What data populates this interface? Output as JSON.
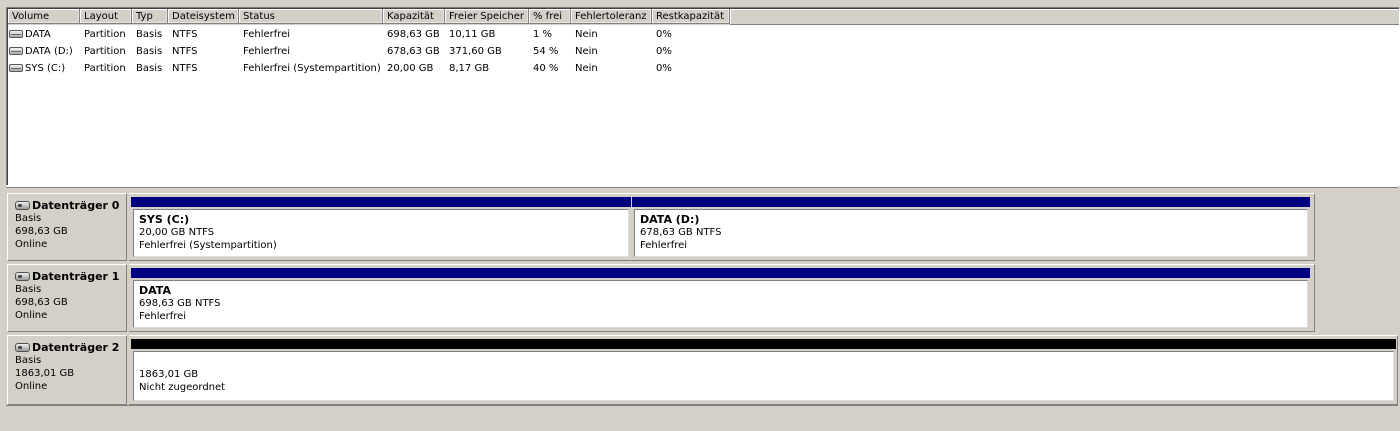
{
  "volume_list": {
    "columns": [
      "Volume",
      "Layout",
      "Typ",
      "Dateisystem",
      "Status",
      "Kapazität",
      "Freier Speicher",
      "% frei",
      "Fehlertoleranz",
      "Restkapazität"
    ],
    "rows": [
      {
        "volume": "DATA",
        "layout": "Partition",
        "typ": "Basis",
        "dateisystem": "NTFS",
        "status": "Fehlerfrei",
        "kapazitaet": "698,63 GB",
        "frei": "10,11 GB",
        "prozent": "1 %",
        "fehlertoleranz": "Nein",
        "rest": "0%"
      },
      {
        "volume": "DATA (D:)",
        "layout": "Partition",
        "typ": "Basis",
        "dateisystem": "NTFS",
        "status": "Fehlerfrei",
        "kapazitaet": "678,63 GB",
        "frei": "371,60 GB",
        "prozent": "54 %",
        "fehlertoleranz": "Nein",
        "rest": "0%"
      },
      {
        "volume": "SYS (C:)",
        "layout": "Partition",
        "typ": "Basis",
        "dateisystem": "NTFS",
        "status": "Fehlerfrei (Systempartition)",
        "kapazitaet": "20,00 GB",
        "frei": "8,17 GB",
        "prozent": "40 %",
        "fehlertoleranz": "Nein",
        "rest": "0%"
      }
    ]
  },
  "disks": [
    {
      "title": "Datenträger 0",
      "type": "Basis",
      "size": "698,63 GB",
      "state": "Online",
      "partitions": [
        {
          "name": "SYS  (C:)",
          "size": "20,00 GB NTFS",
          "status": "Fehlerfrei (Systempartition)",
          "bar_color": "#000080"
        },
        {
          "name": "DATA  (D:)",
          "size": "678,63 GB NTFS",
          "status": "Fehlerfrei",
          "bar_color": "#000080"
        }
      ]
    },
    {
      "title": "Datenträger 1",
      "type": "Basis",
      "size": "698,63 GB",
      "state": "Online",
      "partitions": [
        {
          "name": "DATA",
          "size": "698,63 GB NTFS",
          "status": "Fehlerfrei",
          "bar_color": "#000080"
        }
      ]
    },
    {
      "title": "Datenträger 2",
      "type": "Basis",
      "size": "1863,01 GB",
      "state": "Online",
      "partitions": [
        {
          "name": "",
          "size": "1863,01 GB",
          "status": "Nicht zugeordnet",
          "bar_color": "#000000"
        }
      ]
    }
  ],
  "icons": {
    "volume": "volume-drive-icon",
    "disk": "hard-disk-icon"
  }
}
